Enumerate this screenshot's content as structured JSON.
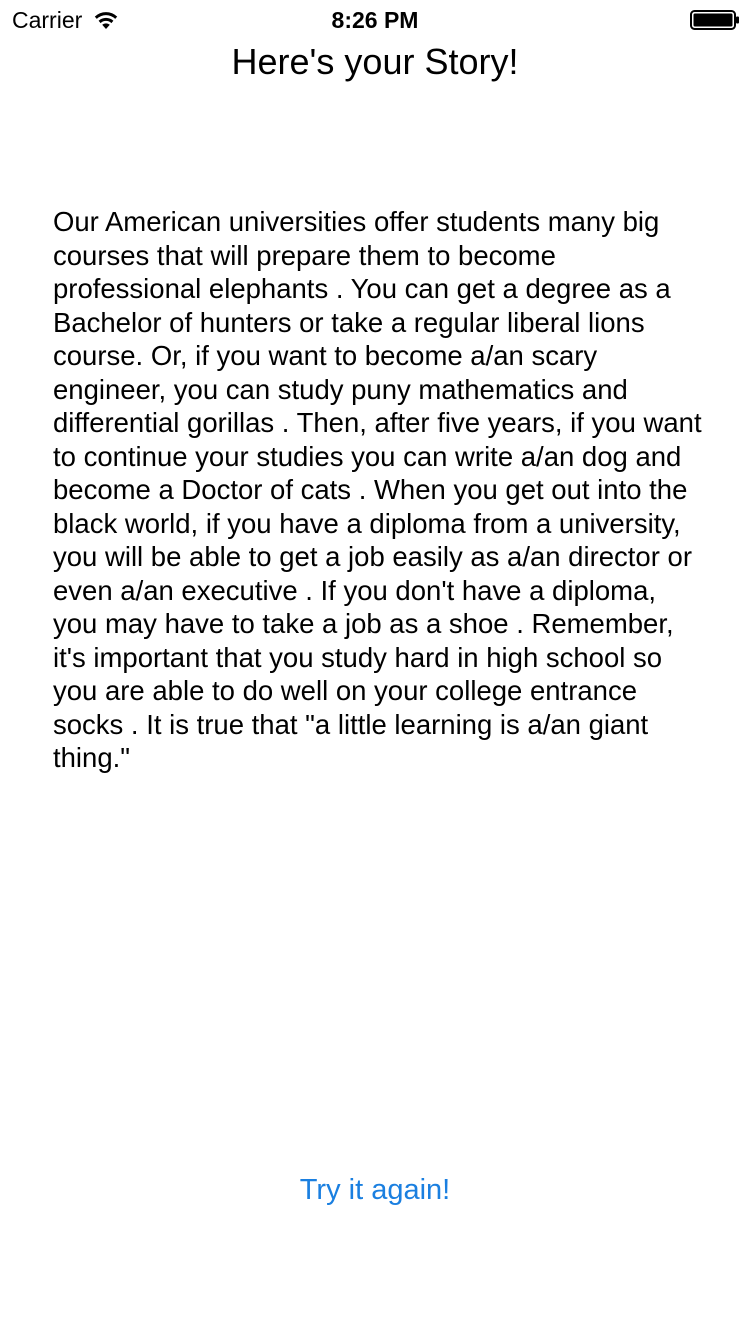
{
  "status_bar": {
    "carrier": "Carrier",
    "time": "8:26 PM",
    "wifi_icon": "wifi-icon",
    "battery_icon": "battery-icon"
  },
  "page": {
    "title": "Here's your Story!",
    "story": "Our American universities offer students many big courses that will prepare them to become professional elephants . You can get a degree as a Bachelor of hunters or take a regular liberal lions course. Or, if you want to become a/an scary engineer, you can study puny mathematics and differential gorillas . Then, after five years, if you want to continue your studies you can write a/an dog and become a Doctor of cats . When you get out into the black world, if you have a diploma from a university, you will be able to get a job easily as a/an director or even a/an executive . If you don't have a diploma, you may have to take a job as a shoe . Remember, it's important that you study hard in high school so you are able to do well on your college entrance socks . It is true that \"a little learning is a/an giant thing.\""
  },
  "actions": {
    "try_again_label": "Try it again!"
  },
  "colors": {
    "accent": "#1a7fe0",
    "text": "#000000",
    "background": "#ffffff"
  }
}
